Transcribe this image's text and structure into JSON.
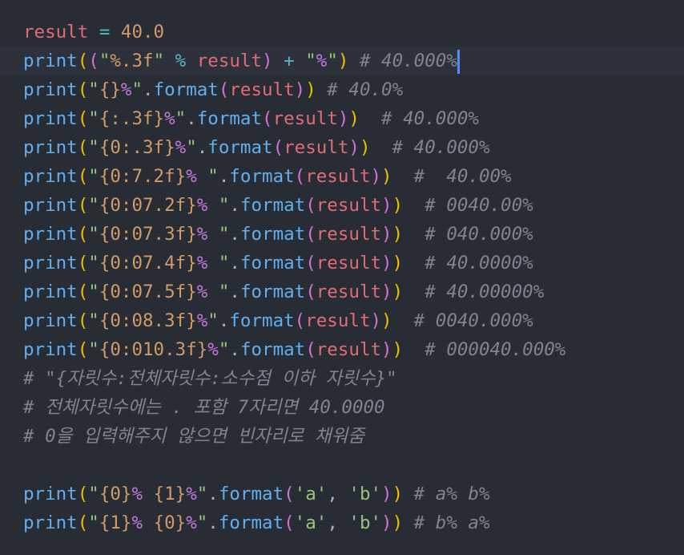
{
  "editor": {
    "theme": "dark",
    "background": "#282c34",
    "lines": [
      {
        "type": "assign",
        "var": "result",
        "op": " = ",
        "value": "40.0"
      },
      {
        "type": "print_pct",
        "fn": "print",
        "p1": "(",
        "p2": "(",
        "q1": "\"",
        "fmt": "%.3f",
        "q2": "\"",
        "op1": " % ",
        "arg": "result",
        "p2c": ")",
        "op2": " + ",
        "q3": "\"",
        "lit": "%",
        "q4": "\"",
        "p1c": ")",
        "comment": " # 40.000%"
      },
      {
        "fn": "print",
        "open": "(",
        "q1": "\"",
        "field": "{}",
        "lit": "%",
        "q2": "\"",
        "dot": ".",
        "method": "format",
        "mopen": "(",
        "arg": "result",
        "mclose": ")",
        "close": ")",
        "comment": " # 40.0%"
      },
      {
        "fn": "print",
        "open": "(",
        "q1": "\"",
        "field": "{:.3f}",
        "lit": "%",
        "q2": "\"",
        "dot": ".",
        "method": "format",
        "mopen": "(",
        "arg": "result",
        "mclose": ")",
        "close": ")",
        "comment": "  # 40.000%"
      },
      {
        "fn": "print",
        "open": "(",
        "q1": "\"",
        "field": "{0:.3f}",
        "lit": "%",
        "q2": "\"",
        "dot": ".",
        "method": "format",
        "mopen": "(",
        "arg": "result",
        "mclose": ")",
        "close": ")",
        "comment": "  # 40.000%"
      },
      {
        "fn": "print",
        "open": "(",
        "q1": "\"",
        "field": "{0:7.2f}",
        "lit": "% ",
        "q2": "\"",
        "dot": ".",
        "method": "format",
        "mopen": "(",
        "arg": "result",
        "mclose": ")",
        "close": ")",
        "comment": "  #  40.00%"
      },
      {
        "fn": "print",
        "open": "(",
        "q1": "\"",
        "field": "{0:07.2f}",
        "lit": "% ",
        "q2": "\"",
        "dot": ".",
        "method": "format",
        "mopen": "(",
        "arg": "result",
        "mclose": ")",
        "close": ")",
        "comment": "  # 0040.00%"
      },
      {
        "fn": "print",
        "open": "(",
        "q1": "\"",
        "field": "{0:07.3f}",
        "lit": "% ",
        "q2": "\"",
        "dot": ".",
        "method": "format",
        "mopen": "(",
        "arg": "result",
        "mclose": ")",
        "close": ")",
        "comment": "  # 040.000%"
      },
      {
        "fn": "print",
        "open": "(",
        "q1": "\"",
        "field": "{0:07.4f}",
        "lit": "% ",
        "q2": "\"",
        "dot": ".",
        "method": "format",
        "mopen": "(",
        "arg": "result",
        "mclose": ")",
        "close": ")",
        "comment": "  # 40.0000%"
      },
      {
        "fn": "print",
        "open": "(",
        "q1": "\"",
        "field": "{0:07.5f}",
        "lit": "% ",
        "q2": "\"",
        "dot": ".",
        "method": "format",
        "mopen": "(",
        "arg": "result",
        "mclose": ")",
        "close": ")",
        "comment": "  # 40.00000%"
      },
      {
        "fn": "print",
        "open": "(",
        "q1": "\"",
        "field": "{0:08.3f}",
        "lit": "%",
        "q2": "\"",
        "dot": ".",
        "method": "format",
        "mopen": "(",
        "arg": "result",
        "mclose": ")",
        "close": ")",
        "comment": "  # 0040.000%"
      },
      {
        "fn": "print",
        "open": "(",
        "q1": "\"",
        "field": "{0:010.3f}",
        "lit": "%",
        "q2": "\"",
        "dot": ".",
        "method": "format",
        "mopen": "(",
        "arg": "result",
        "mclose": ")",
        "close": ")",
        "comment": "  # 000040.000%"
      },
      {
        "type": "comment",
        "text": "# \"{자릿수:전체자릿수:소수점 이하 자릿수}\""
      },
      {
        "type": "comment",
        "text": "# 전체자릿수에는 . 포함 7자리면 40.0000"
      },
      {
        "type": "comment",
        "text": "# 0을 입력해주지 않으면 빈자리로 채워줌"
      },
      {
        "type": "blank"
      },
      {
        "fn": "print",
        "open": "(",
        "q1": "\"",
        "field": "{0}",
        "lit1": "% ",
        "field2": "{1}",
        "lit2": "%",
        "q2": "\"",
        "dot": ".",
        "method": "format",
        "mopen": "(",
        "a1": "'a'",
        "sep": ", ",
        "a2": "'b'",
        "mclose": ")",
        "close": ")",
        "comment": " # a% b%"
      },
      {
        "fn": "print",
        "open": "(",
        "q1": "\"",
        "field": "{1}",
        "lit1": "% ",
        "field2": "{0}",
        "lit2": "%",
        "q2": "\"",
        "dot": ".",
        "method": "format",
        "mopen": "(",
        "a1": "'a'",
        "sep": ", ",
        "a2": "'b'",
        "mclose": ")",
        "close": ")",
        "comment": " # b% a%"
      }
    ]
  }
}
